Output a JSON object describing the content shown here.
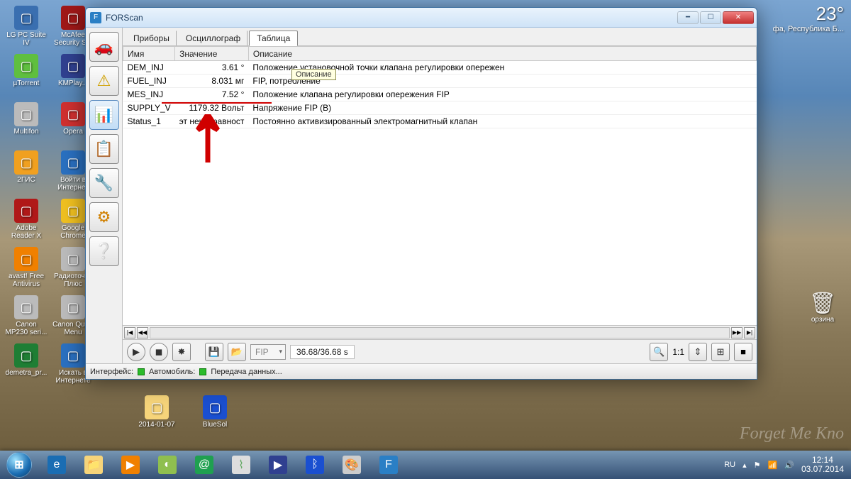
{
  "weather": {
    "temp": "23°",
    "loc": "фа, Республика Б..."
  },
  "watermark": "Forget Me Kno",
  "trash_label": "орзина",
  "desktop_icons_col1": [
    {
      "label": "LG PC Suite IV",
      "c": "#3a6fb0"
    },
    {
      "label": "µTorrent",
      "c": "#5fbf3f"
    },
    {
      "label": "Multifon",
      "c": "#bbb"
    },
    {
      "label": "2ГИС",
      "c": "#f0a020"
    },
    {
      "label": "Adobe Reader X",
      "c": "#b01818"
    },
    {
      "label": "avast! Free Antivirus",
      "c": "#f08000"
    },
    {
      "label": "Canon MP230 seri...",
      "c": "#bbb"
    },
    {
      "label": "demetra_pr...",
      "c": "#1e7e34"
    }
  ],
  "desktop_icons_col2": [
    {
      "label": "McAfee Security S...",
      "c": "#a01818"
    },
    {
      "label": "KMPlay...",
      "c": "#304090"
    },
    {
      "label": "Opera",
      "c": "#d03030"
    },
    {
      "label": "Войти в Интернет",
      "c": "#2a70c0"
    },
    {
      "label": "Google Chrome",
      "c": "#f0c020"
    },
    {
      "label": "Радиоточка Плюс",
      "c": "#bbb"
    },
    {
      "label": "Canon Quick Menu",
      "c": "#bbb"
    },
    {
      "label": "Искать в Интернете",
      "c": "#2a70c0"
    }
  ],
  "extra_icons": [
    {
      "label": "2014-01-07",
      "c": "#f6d47a"
    },
    {
      "label": "BlueSol",
      "c": "#1a4fd0"
    }
  ],
  "forscan": {
    "title": "FORScan",
    "tabs": [
      "Приборы",
      "Осциллограф",
      "Таблица"
    ],
    "active_tab": 2,
    "columns": [
      "Имя",
      "Значение",
      "Описание"
    ],
    "rows": [
      {
        "name": "DEM_INJ",
        "value": "3.61 °",
        "desc": "Положение установочной точки клапана регулировки опережен"
      },
      {
        "name": "FUEL_INJ",
        "value": "8.031 мг",
        "desc": "FIP, потребление"
      },
      {
        "name": "MES_INJ",
        "value": "7.52 °",
        "desc": "Положение клапана регулировки опережения FIP"
      },
      {
        "name": "SUPPLY_V",
        "value": "1179.32 Вольт",
        "desc": "Напряжение FIP (В)"
      },
      {
        "name": "Status_1",
        "value": "эт неисправност",
        "desc": "Постоянно активизированный электромагнитный клапан"
      }
    ],
    "tooltip": "Описание",
    "combo": "FIP",
    "time": "36.68/36.68 s",
    "zoom_label": "1:1",
    "status": {
      "iface": "Интерфейс:",
      "car": "Автомобиль:",
      "data": "Передача данных..."
    }
  },
  "tray": {
    "lang": "RU",
    "time": "12:14",
    "date": "03.07.2014"
  }
}
